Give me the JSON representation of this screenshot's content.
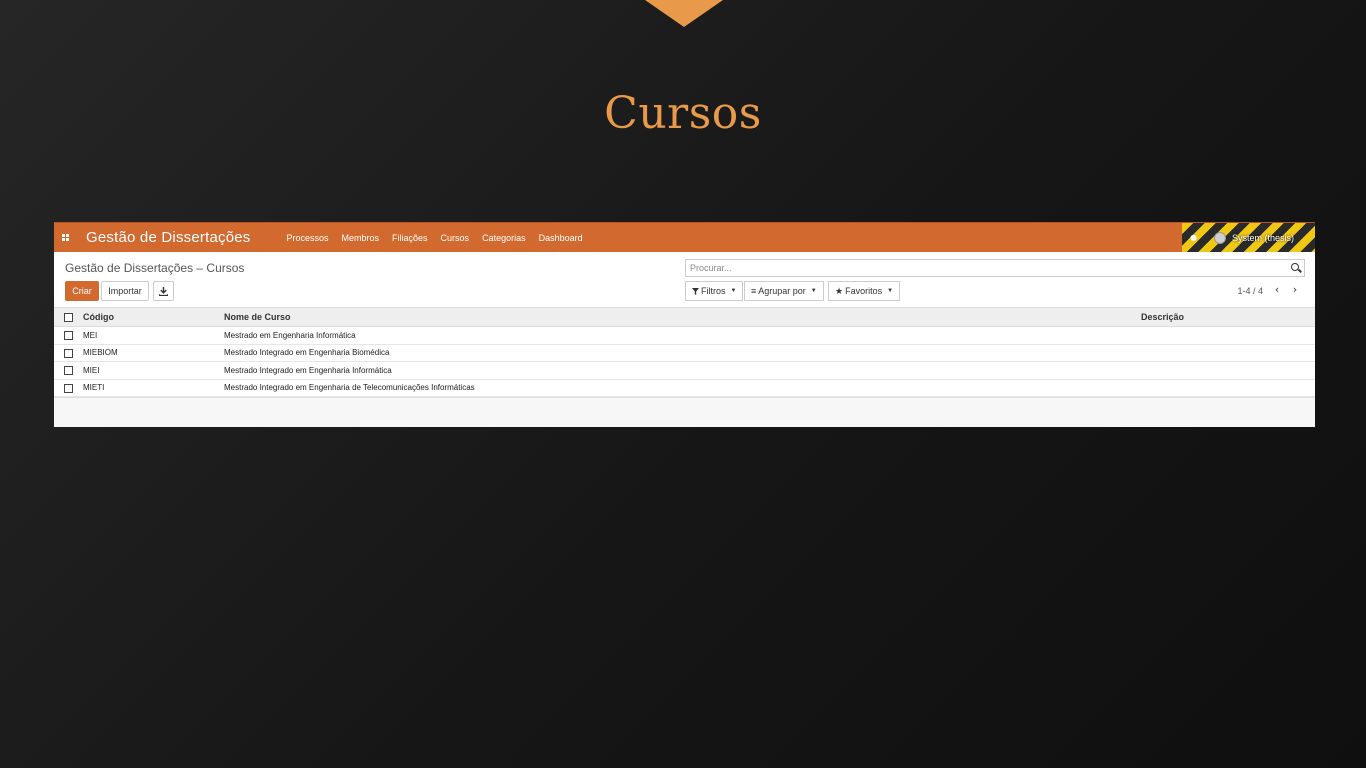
{
  "slide": {
    "title": "Cursos"
  },
  "navbar": {
    "brand": "Gestão de Dissertações",
    "menu": [
      "Processos",
      "Membros",
      "Filiações",
      "Cursos",
      "Categorias",
      "Dashboard"
    ],
    "system_label": "System (thesis)"
  },
  "control_panel": {
    "breadcrumb": "Gestão de Dissertações – Cursos",
    "create_label": "Criar",
    "import_label": "Importar",
    "search_placeholder": "Procurar...",
    "filters_label": "Filtros",
    "group_by_label": "Agrupar por",
    "favorites_label": "Favoritos",
    "pager": "1-4 / 4"
  },
  "table": {
    "headers": [
      "Código",
      "Nome de Curso",
      "Descrição"
    ],
    "rows": [
      {
        "code": "MEI",
        "name": "Mestrado em Engenharia Informática",
        "description": ""
      },
      {
        "code": "MIEBIOM",
        "name": "Mestrado Integrado em Engenharia Biomédica",
        "description": ""
      },
      {
        "code": "MIEI",
        "name": "Mestrado Integrado em Engenharia Informática",
        "description": ""
      },
      {
        "code": "MIETI",
        "name": "Mestrado Integrado em Engenharia de Telecomunicações Informáticas",
        "description": ""
      }
    ]
  },
  "colors": {
    "accent": "#d26a30",
    "title": "#e89a4a"
  }
}
